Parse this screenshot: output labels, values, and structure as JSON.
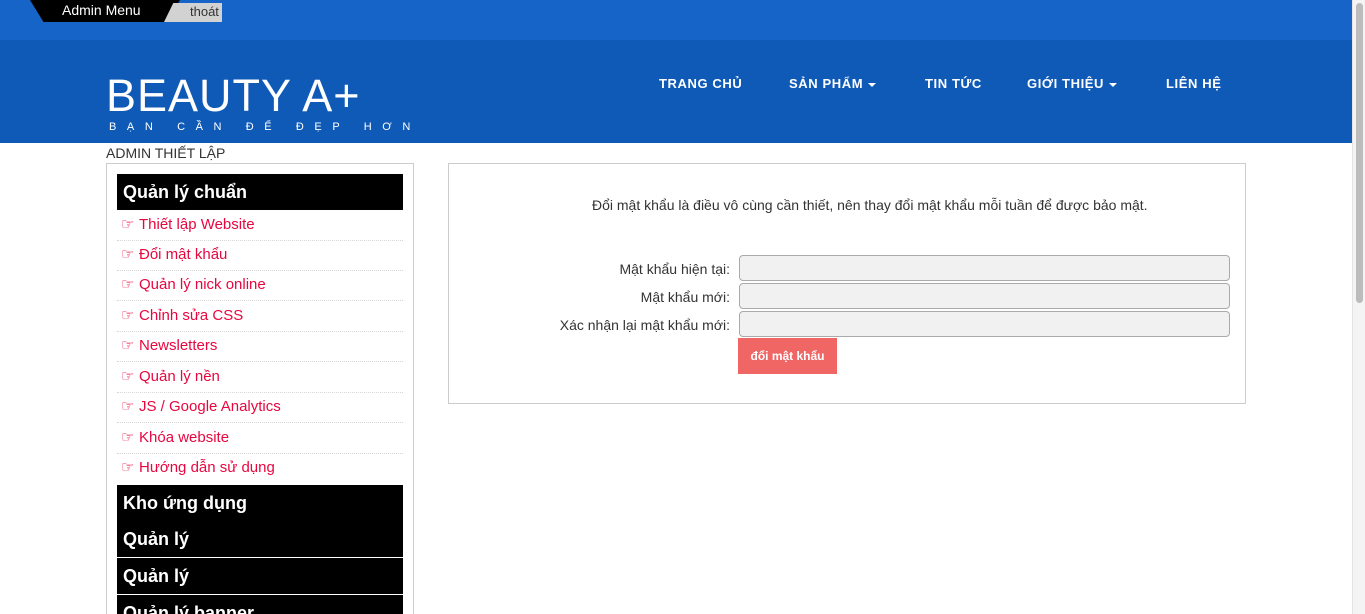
{
  "adminbar": {
    "menu_label": "Admin Menu",
    "logout_label": "thoát"
  },
  "brand": {
    "name": "BEAUTY A+",
    "slogan": "BẠN CẦN ĐỂ ĐẸP HƠN"
  },
  "nav": {
    "items": [
      {
        "label": "TRANG CHỦ"
      },
      {
        "label": "SẢN PHẨM"
      },
      {
        "label": "TIN TỨC"
      },
      {
        "label": "GIỚI THIỆU"
      },
      {
        "label": "LIÊN HỆ"
      }
    ]
  },
  "section_label": "ADMIN THIẾT LẬP",
  "sidebar": {
    "group_title": "Quản lý chuẩn",
    "link_icon": "hand-pointing-right-icon",
    "links": [
      {
        "label": "Thiết lập Website"
      },
      {
        "label": "Đổi mật khẩu"
      },
      {
        "label": "Quản lý nick online"
      },
      {
        "label": "Chỉnh sửa CSS"
      },
      {
        "label": "Newsletters"
      },
      {
        "label": "Quản lý nền"
      },
      {
        "label": "JS / Google Analytics"
      },
      {
        "label": "Khóa website"
      },
      {
        "label": "Hướng dẫn sử dụng"
      }
    ],
    "sections": [
      {
        "label": "Kho ứng dụng"
      },
      {
        "label": "Quản lý"
      },
      {
        "label": "Quản lý"
      },
      {
        "label": "Quản lý banner"
      }
    ]
  },
  "form": {
    "intro": "Đổi mật khẩu là điều vô cùng cần thiết, nên thay đổi mật khẩu mỗi tuần để được bảo mật.",
    "fields": [
      {
        "label": "Mật khẩu hiện tại:",
        "value": ""
      },
      {
        "label": "Mật khẩu mới:",
        "value": ""
      },
      {
        "label": "Xác nhận lại mật khẩu mới:",
        "value": ""
      }
    ],
    "submit_label": "đổi mật khẩu"
  },
  "colors": {
    "header_blue": "#0f5ab7",
    "adminbar_blue": "#1664c7",
    "link_red": "#e8063f",
    "button_red": "#f06665"
  }
}
